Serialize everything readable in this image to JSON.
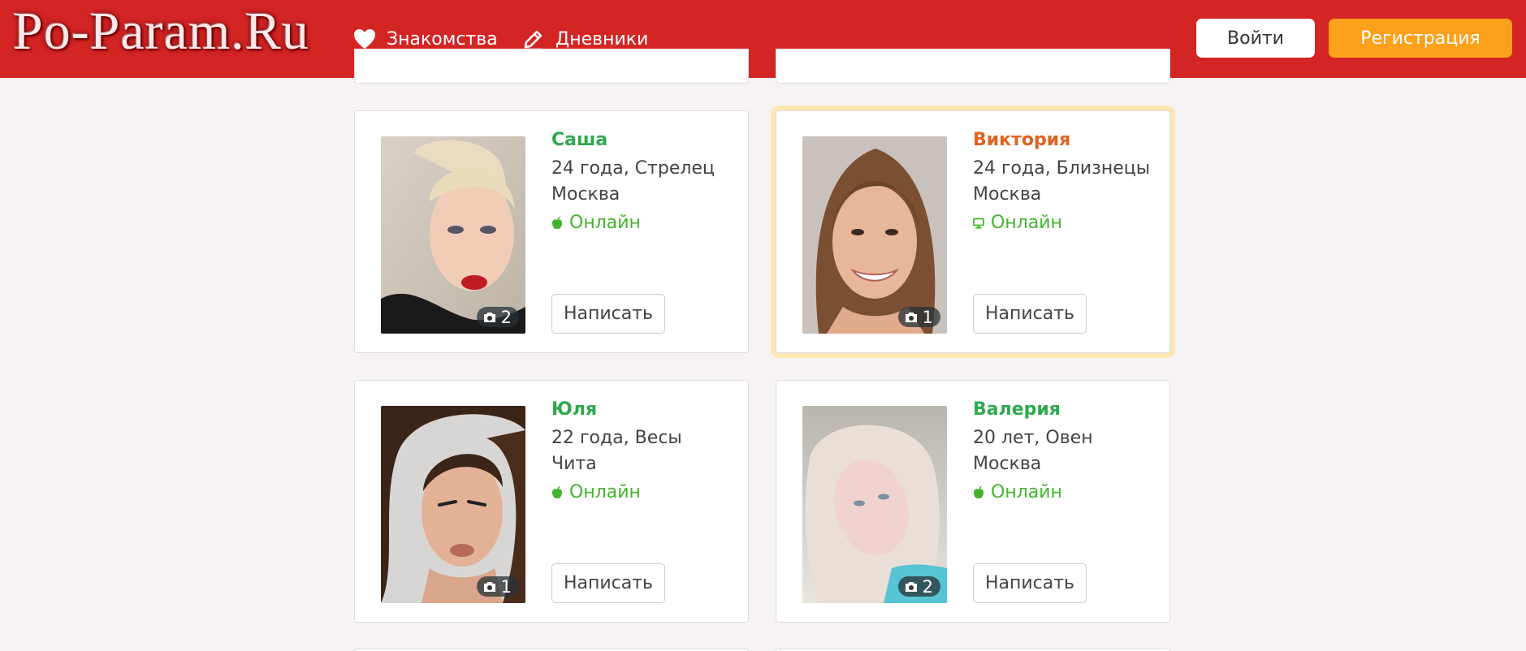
{
  "header": {
    "logo": "Po-Param.Ru",
    "nav": [
      {
        "label": "Знакомства",
        "icon": "heart-icon"
      },
      {
        "label": "Дневники",
        "icon": "pencil-icon"
      }
    ],
    "login_label": "Войти",
    "register_label": "Регистрация",
    "colors": {
      "header_bg": "#d42525",
      "register_bg": "#fda01a"
    }
  },
  "profiles": [
    {
      "name": "Саша",
      "age_sign": "24 года, Стрелец",
      "city": "Москва",
      "status": "Онлайн",
      "device_icon": "apple-icon",
      "photo_count": "2",
      "write_label": "Написать",
      "name_color": "#2fa84f",
      "highlighted": false
    },
    {
      "name": "Виктория",
      "age_sign": "24 года, Близнецы",
      "city": "Москва",
      "status": "Онлайн",
      "device_icon": "desktop-icon",
      "photo_count": "1",
      "write_label": "Написать",
      "name_color": "#e0631f",
      "highlighted": true
    },
    {
      "name": "Юля",
      "age_sign": "22 года, Весы",
      "city": "Чита",
      "status": "Онлайн",
      "device_icon": "apple-icon",
      "photo_count": "1",
      "write_label": "Написать",
      "name_color": "#2fa84f",
      "highlighted": false
    },
    {
      "name": "Валерия",
      "age_sign": "20 лет, Овен",
      "city": "Москва",
      "status": "Онлайн",
      "device_icon": "apple-icon",
      "photo_count": "2",
      "write_label": "Написать",
      "name_color": "#2fa84f",
      "highlighted": false
    }
  ]
}
